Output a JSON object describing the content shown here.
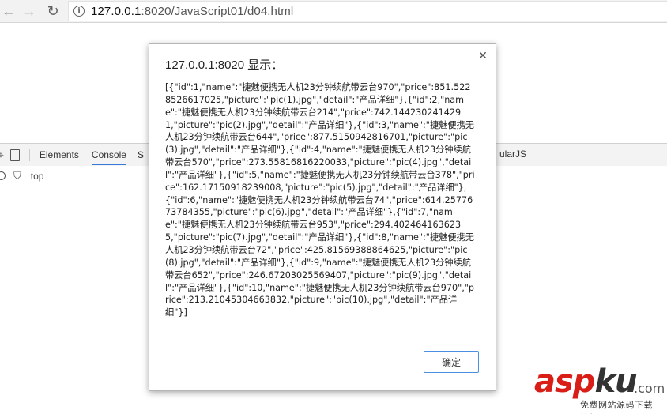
{
  "browser": {
    "url_host": "127.0.0.1",
    "url_rest": ":8020/JavaScript01/d04.html"
  },
  "devtools": {
    "tabs": [
      "Elements",
      "Console",
      "S",
      "ularJS"
    ],
    "context": "top"
  },
  "dialog": {
    "title": "127.0.0.1:8020 显示：",
    "message": "[{\"id\":1,\"name\":\"捷魅便携无人机23分钟续航带云台970\",\"price\":851.5228526617025,\"picture\":\"pic(1).jpg\",\"detail\":\"产品详细\"},{\"id\":2,\"name\":\"捷魅便携无人机23分钟续航带云台214\",\"price\":742.1442302414291,\"picture\":\"pic(2).jpg\",\"detail\":\"产品详细\"},{\"id\":3,\"name\":\"捷魅便携无人机23分钟续航带云台644\",\"price\":877.5150942816701,\"picture\":\"pic(3).jpg\",\"detail\":\"产品详细\"},{\"id\":4,\"name\":\"捷魅便携无人机23分钟续航带云台570\",\"price\":273.55816816220033,\"picture\":\"pic(4).jpg\",\"detail\":\"产品详细\"},{\"id\":5,\"name\":\"捷魅便携无人机23分钟续航带云台378\",\"price\":162.17150918239008,\"picture\":\"pic(5).jpg\",\"detail\":\"产品详细\"},{\"id\":6,\"name\":\"捷魅便携无人机23分钟续航带云台74\",\"price\":614.2577673784355,\"picture\":\"pic(6).jpg\",\"detail\":\"产品详细\"},{\"id\":7,\"name\":\"捷魅便携无人机23分钟续航带云台953\",\"price\":294.4024641636235,\"picture\":\"pic(7).jpg\",\"detail\":\"产品详细\"},{\"id\":8,\"name\":\"捷魅便携无人机23分钟续航带云台72\",\"price\":425.81569388864625,\"picture\":\"pic(8).jpg\",\"detail\":\"产品详细\"},{\"id\":9,\"name\":\"捷魅便携无人机23分钟续航带云台652\",\"price\":246.67203025569407,\"picture\":\"pic(9).jpg\",\"detail\":\"产品详细\"},{\"id\":10,\"name\":\"捷魅便携无人机23分钟续航带云台970\",\"price\":213.21045304663832,\"picture\":\"pic(10).jpg\",\"detail\":\"产品详细\"}]",
    "ok_label": "确定",
    "close_glyph": "✕"
  },
  "watermark": {
    "brand_a": "asp",
    "brand_k": "ku",
    "domain": ".com",
    "tagline": "免费网站源码下载站！"
  },
  "colors": {
    "accent": "#3879d9",
    "ok_border": "#4a90e2",
    "watermark_red": "#d91e18"
  }
}
